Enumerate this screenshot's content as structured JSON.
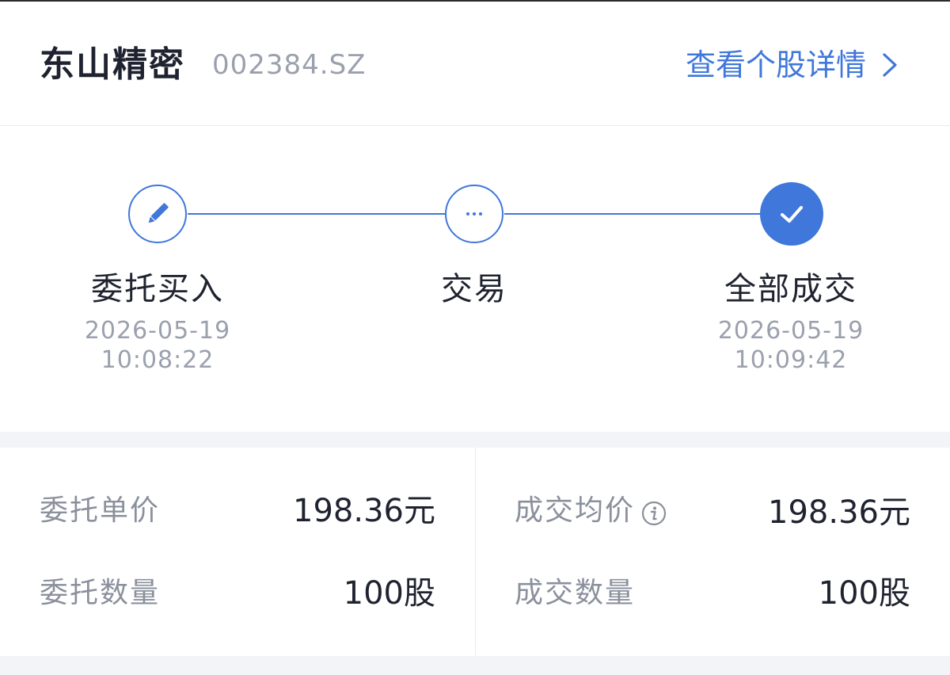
{
  "header": {
    "stock_name": "东山精密",
    "stock_code": "002384.SZ",
    "detail_link": "查看个股详情"
  },
  "steps": [
    {
      "label": "委托买入",
      "date": "2026-05-19",
      "time": "10:08:22",
      "icon": "pencil-icon",
      "state": "completed"
    },
    {
      "label": "交易",
      "date": "",
      "time": "",
      "icon": "ellipsis-icon",
      "state": "completed"
    },
    {
      "label": "全部成交",
      "date": "2026-05-19",
      "time": "10:09:42",
      "icon": "check-icon",
      "state": "current"
    }
  ],
  "order": {
    "price_label": "委托单价",
    "price_value": "198.36元",
    "qty_label": "委托数量",
    "qty_value": "100股"
  },
  "fill": {
    "avg_price_label": "成交均价",
    "avg_price_value": "198.36元",
    "qty_label": "成交数量",
    "qty_value": "100股"
  },
  "colors": {
    "accent": "#3f77db",
    "text_primary": "#1f2330",
    "text_secondary": "#9aa0ad",
    "separator": "#f3f4f7"
  }
}
